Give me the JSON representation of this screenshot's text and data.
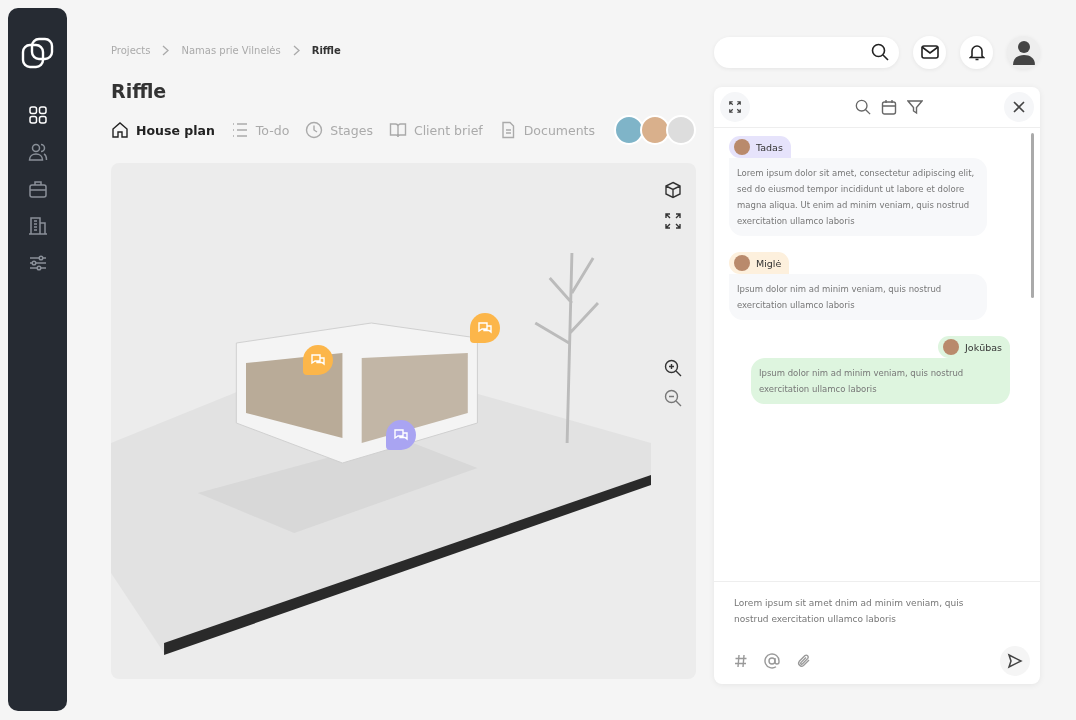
{
  "sidebar": {
    "items": [
      {
        "selected": true
      },
      {
        "selected": false
      },
      {
        "selected": false
      },
      {
        "selected": false
      },
      {
        "selected": false
      }
    ]
  },
  "breadcrumb": [
    "Projects",
    "Namas prie Vilnelės",
    "Riffle"
  ],
  "title": "Riffle",
  "tabs": [
    {
      "label": "House plan",
      "selected": true
    },
    {
      "label": "To-do",
      "selected": false
    },
    {
      "label": "Stages",
      "selected": false
    },
    {
      "label": "Client brief",
      "selected": false
    },
    {
      "label": "Documents",
      "selected": false
    }
  ],
  "viewer": {
    "pins": [
      {
        "color": "#fcb64a"
      },
      {
        "color": "#fcb64a"
      },
      {
        "color": "#a9a4f2"
      }
    ]
  },
  "chat": {
    "messages": [
      {
        "author": "Tadas",
        "kind": "incoming",
        "color": "#e6e3fb",
        "text": "Lorem ipsum dolor sit amet, consectetur adipiscing elit, sed do eiusmod tempor incididunt ut labore et dolore magna aliqua. Ut enim ad minim veniam, quis nostrud exercitation ullamco laboris"
      },
      {
        "author": "Miglė",
        "kind": "incoming",
        "color": "#fdf0dd",
        "text": "Ipsum dolor nim ad minim veniam, quis nostrud exercitation ullamco laboris"
      },
      {
        "author": "Jokūbas",
        "kind": "outgoing",
        "color": "#def5df",
        "text": "Ipsum dolor nim ad minim veniam, quis nostrud exercitation ullamco laboris"
      }
    ],
    "composer": {
      "value": "Lorem ipsum sit amet dnim ad minim veniam, quis nostrud exercitation ullamco laboris"
    }
  }
}
